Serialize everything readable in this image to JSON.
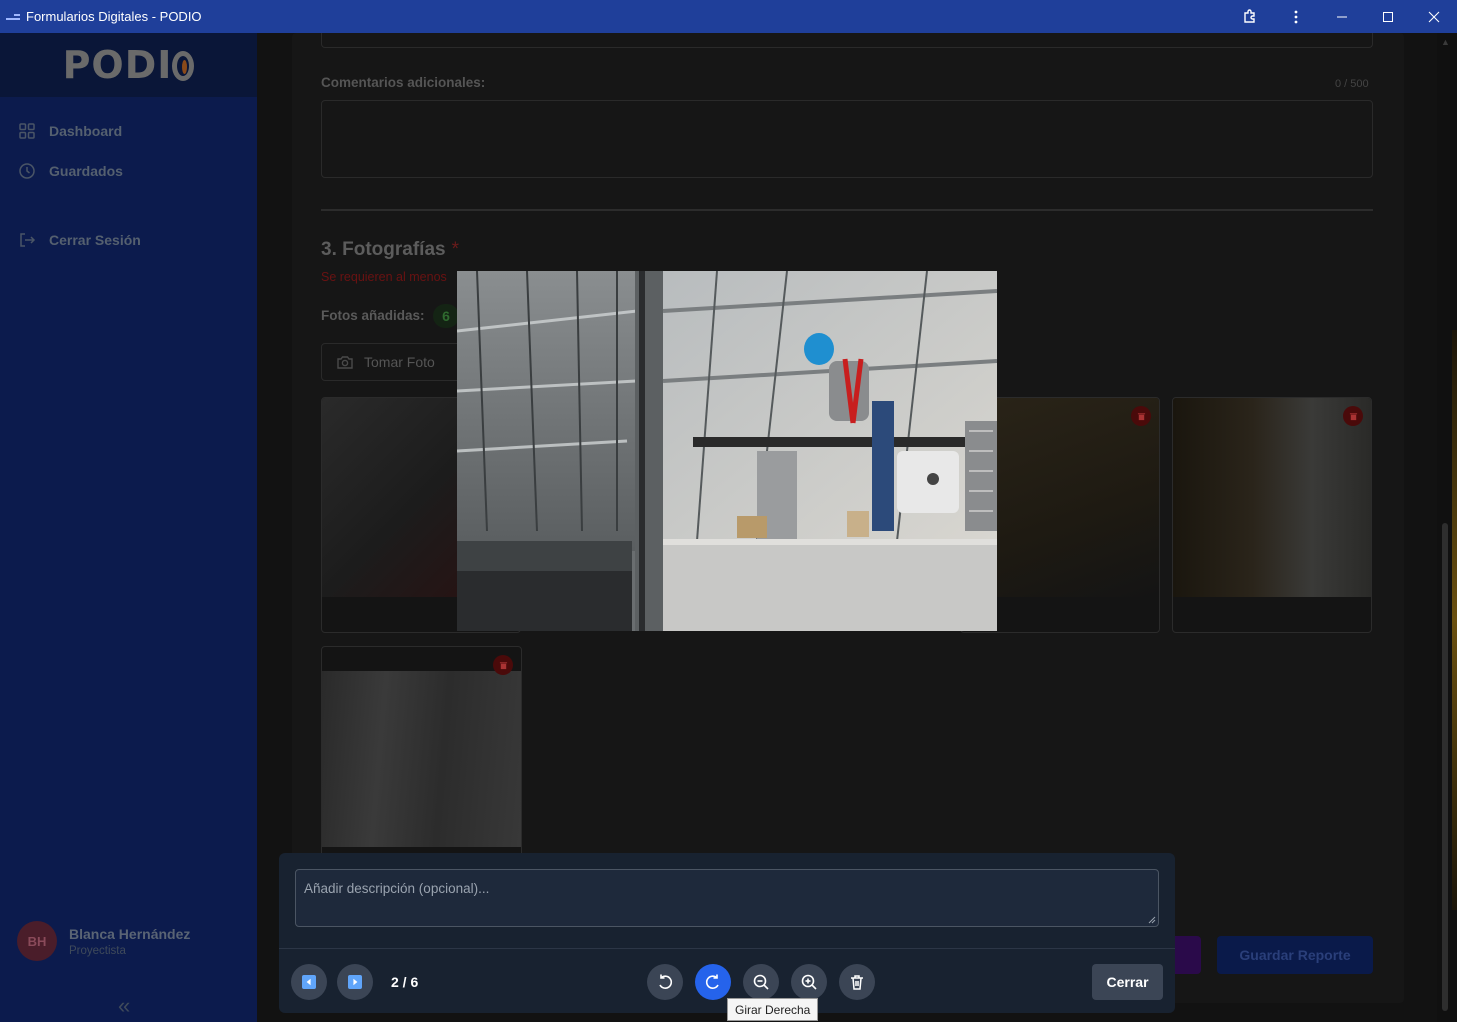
{
  "window": {
    "title": "Formularios Digitales - PODIO"
  },
  "sidebar": {
    "logo": "PODI",
    "items": [
      {
        "label": "Dashboard",
        "icon": "grid-icon"
      },
      {
        "label": "Guardados",
        "icon": "clock-icon"
      },
      {
        "label": "Cerrar Sesión",
        "icon": "logout-icon"
      }
    ],
    "user": {
      "initials": "BH",
      "name": "Blanca Hernández",
      "role": "Proyectista"
    }
  },
  "form": {
    "comments_label": "Comentarios adicionales:",
    "comments_counter": "0 / 500",
    "section_title": "3. Fotografías",
    "required_mark": "*",
    "warning": "Se requieren al menos",
    "photos_label": "Fotos añadidas:",
    "photos_count": "6",
    "take_photo_label": "Tomar Foto",
    "save_report_label": "Guardar Reporte"
  },
  "viewer": {
    "description_placeholder": "Añadir descripción (opcional)...",
    "page_indicator": "2 / 6",
    "close_label": "Cerrar",
    "tooltip": "Girar Derecha",
    "accent_color": "#2563eb"
  }
}
